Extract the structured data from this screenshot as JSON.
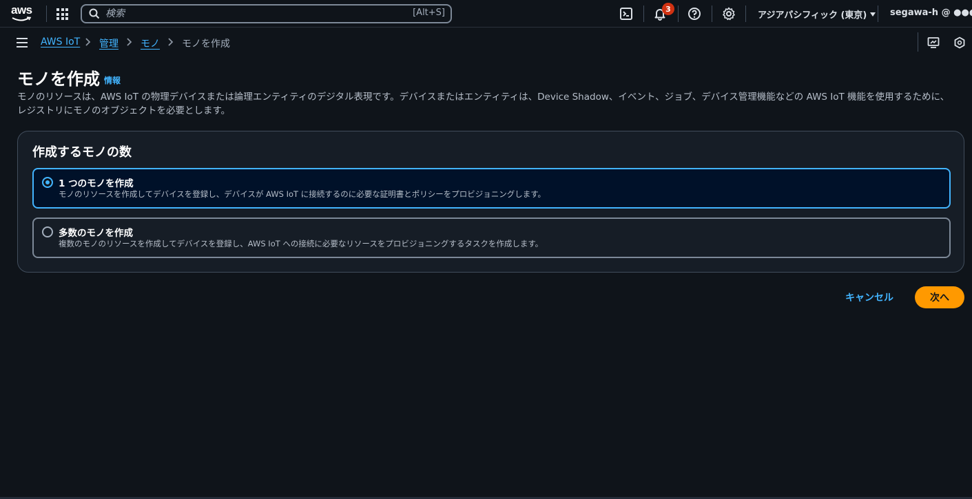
{
  "topnav": {
    "logo_text": "aws",
    "search": {
      "placeholder": "検索",
      "shortcut": "[Alt+S]"
    },
    "notification_count": "3",
    "region": "アジアパシフィック (東京)",
    "account": "segawa-h @ ●●●",
    "icons": [
      "grid-icon",
      "search-icon",
      "cloudshell-icon",
      "bell-icon",
      "help-icon",
      "gear-icon"
    ]
  },
  "breadcrumb": {
    "items": [
      {
        "label": "AWS IoT",
        "link": true
      },
      {
        "label": "管理",
        "link": true
      },
      {
        "label": "モノ",
        "link": true
      },
      {
        "label": "モノを作成",
        "link": false
      }
    ]
  },
  "header": {
    "title": "モノを作成",
    "info": "情報",
    "description": "モノのリソースは、AWS IoT の物理デバイスまたは論理エンティティのデジタル表現です。デバイスまたはエンティティは、Device Shadow、イベント、ジョブ、デバイス管理機能などの AWS IoT 機能を使用するために、レジストリにモノのオブジェクトを必要とします。"
  },
  "form": {
    "section_title": "作成するモノの数",
    "options": [
      {
        "label": "1 つのモノを作成",
        "description": "モノのリソースを作成してデバイスを登録し、デバイスが AWS IoT に接続するのに必要な証明書とポリシーをプロビジョニングします。",
        "selected": true
      },
      {
        "label": "多数のモノを作成",
        "description": "複数のモノのリソースを作成してデバイスを登録し、AWS IoT への接続に必要なリソースをプロビジョニングするタスクを作成します。",
        "selected": false
      }
    ]
  },
  "actions": {
    "cancel": "キャンセル",
    "next": "次へ"
  },
  "colors": {
    "accent": "#42b4ff",
    "primary_button": "#ff9900",
    "background": "#0f141a",
    "badge": "#d13212"
  }
}
